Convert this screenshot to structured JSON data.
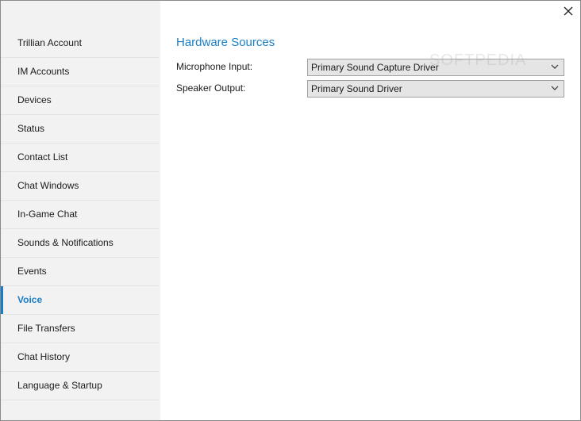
{
  "sidebar": {
    "items": [
      {
        "label": "Trillian Account"
      },
      {
        "label": "IM Accounts"
      },
      {
        "label": "Devices"
      },
      {
        "label": "Status"
      },
      {
        "label": "Contact List"
      },
      {
        "label": "Chat Windows"
      },
      {
        "label": "In-Game Chat"
      },
      {
        "label": "Sounds & Notifications"
      },
      {
        "label": "Events"
      },
      {
        "label": "Voice",
        "active": true
      },
      {
        "label": "File Transfers"
      },
      {
        "label": "Chat History"
      },
      {
        "label": "Language & Startup"
      }
    ]
  },
  "main": {
    "section_title": "Hardware Sources",
    "fields": [
      {
        "label": "Microphone Input:",
        "value": "Primary Sound Capture Driver"
      },
      {
        "label": "Speaker Output:",
        "value": "Primary Sound Driver"
      }
    ]
  },
  "window": {
    "close_icon": "close-icon"
  },
  "watermark": "SOFTPEDIA",
  "colors": {
    "accent": "#1a7ec7",
    "sidebar_bg": "#f2f2f2",
    "select_bg": "#e5e5e5"
  }
}
